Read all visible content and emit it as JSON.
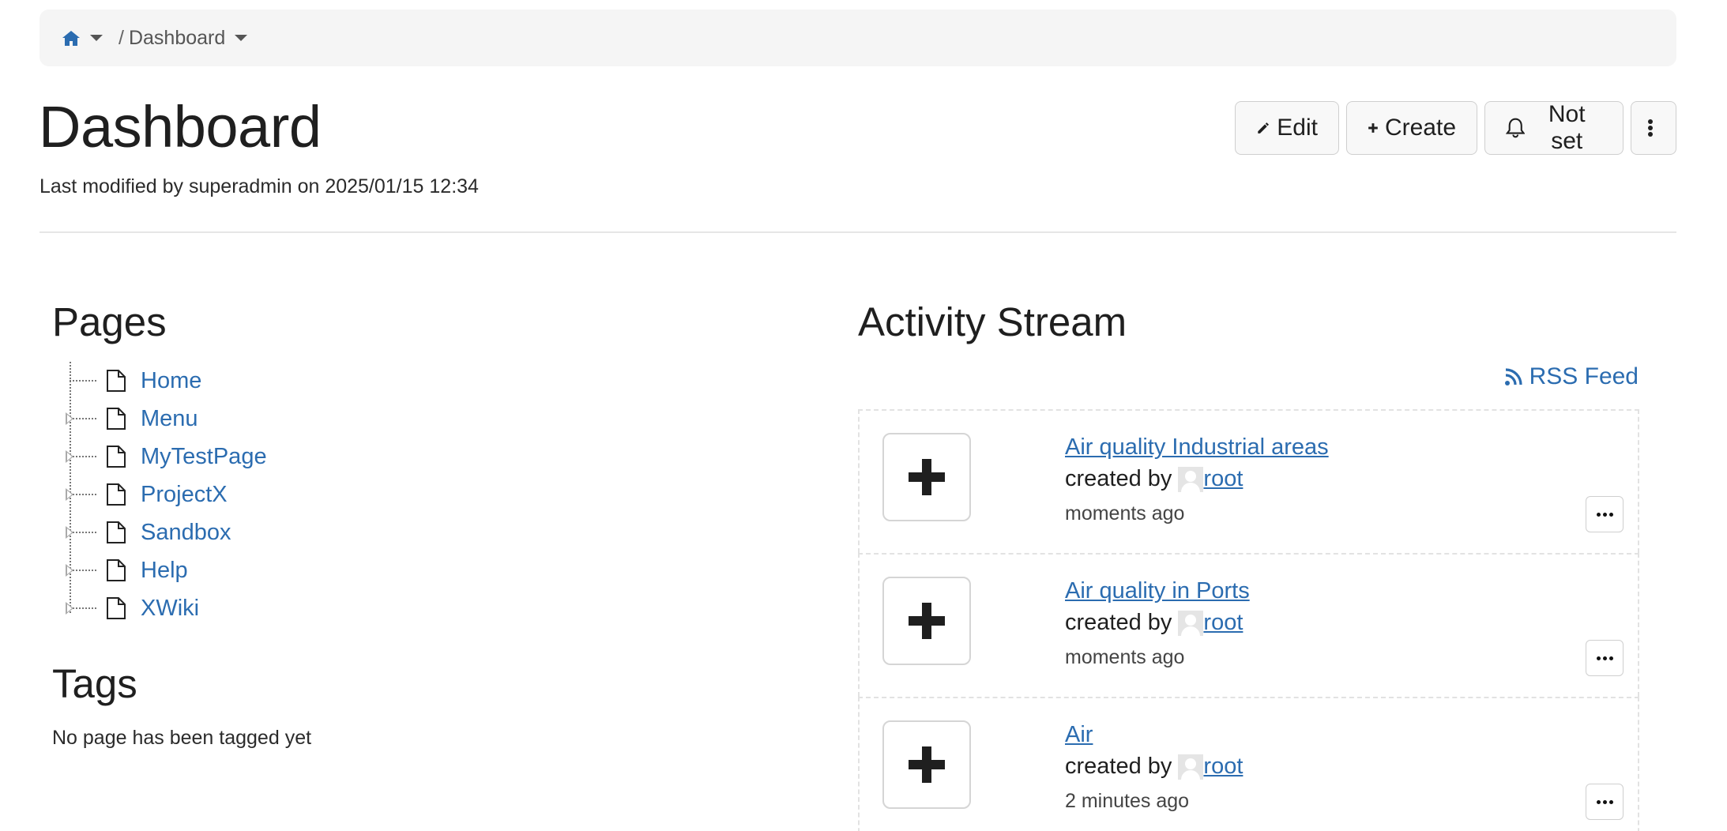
{
  "breadcrumb": {
    "home_icon": "home-icon",
    "current": "Dashboard"
  },
  "header": {
    "title": "Dashboard",
    "last_modified": "Last modified by superadmin on 2025/01/15 12:34"
  },
  "actions": {
    "edit_label": "Edit",
    "create_label": "Create",
    "notify_label": "Not set"
  },
  "pages": {
    "title": "Pages",
    "items": [
      {
        "label": "Home"
      },
      {
        "label": "Menu"
      },
      {
        "label": "MyTestPage"
      },
      {
        "label": "ProjectX"
      },
      {
        "label": "Sandbox"
      },
      {
        "label": "Help"
      },
      {
        "label": "XWiki"
      }
    ]
  },
  "tags": {
    "title": "Tags",
    "empty_text": "No page has been tagged yet"
  },
  "activity": {
    "title": "Activity Stream",
    "rss_label": "RSS Feed",
    "events": [
      {
        "title": "Air quality Industrial areas",
        "by_text": "created by",
        "user": "root",
        "time": "moments ago"
      },
      {
        "title": "Air quality in Ports",
        "by_text": "created by",
        "user": "root",
        "time": "moments ago"
      },
      {
        "title": "Air",
        "by_text": "created by",
        "user": "root",
        "time": "2 minutes ago"
      }
    ]
  },
  "colors": {
    "link": "#2b6cb0",
    "text": "#1f1f1f",
    "breadcrumb_bg": "#f5f5f5"
  }
}
